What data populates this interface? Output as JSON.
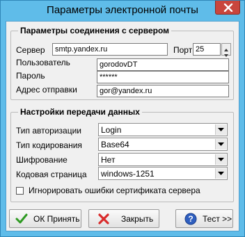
{
  "window": {
    "title": "Параметры электронной почты"
  },
  "connection": {
    "group_title": "Параметры соединения с сервером",
    "server_label": "Сервер",
    "server_value": "smtp.yandex.ru",
    "port_label": "Порт",
    "port_value": "25",
    "user_label": "Пользователь",
    "user_value": "gorodovDT",
    "password_label": "Пароль",
    "password_value": "******",
    "from_label": "Адрес отправки",
    "from_value": "gor@yandex.ru"
  },
  "transfer": {
    "group_title": "Настройки передачи данных",
    "auth_label": "Тип авторизации",
    "auth_value": "Login",
    "encoding_label": "Тип кодирования",
    "encoding_value": "Base64",
    "encryption_label": "Шифрование",
    "encryption_value": "Нет",
    "codepage_label": "Кодовая страница",
    "codepage_value": "windows-1251",
    "ignore_cert_label": "Игнорировать ошибки сертификата сервера",
    "ignore_cert_checked": false
  },
  "buttons": {
    "ok_label": "ОК Принять",
    "close_label": "Закрыть",
    "test_label": "Тест >>"
  },
  "colors": {
    "title_bar": "#5fbce9",
    "close_button": "#c9463d",
    "ok_icon": "#2e9a22",
    "close_icon": "#d92b2b",
    "help_icon": "#2f5fbf"
  },
  "icons": [
    "close-icon",
    "checkmark-icon",
    "cross-icon",
    "help-icon",
    "dropdown-arrow-icon"
  ]
}
